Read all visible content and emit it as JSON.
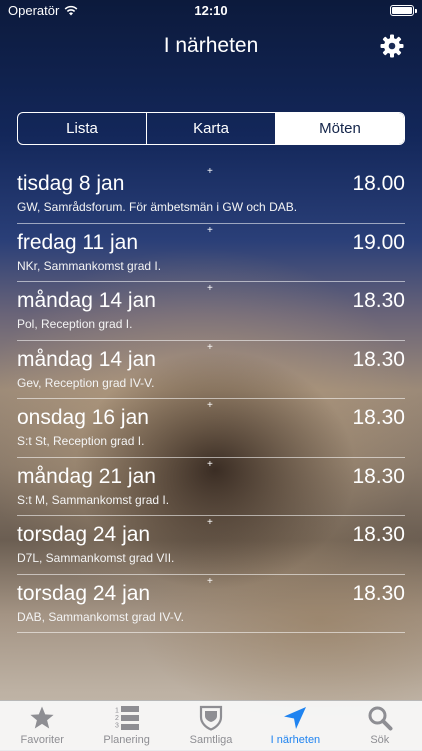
{
  "status_bar": {
    "carrier": "Operatör",
    "time": "12:10"
  },
  "nav": {
    "title": "I närheten",
    "settings_icon": "gear-icon"
  },
  "segments": [
    {
      "label": "Lista",
      "selected": false
    },
    {
      "label": "Karta",
      "selected": false
    },
    {
      "label": "Möten",
      "selected": true
    }
  ],
  "meetings": [
    {
      "date": "tisdag 8 jan",
      "description": "GW, Samrådsforum. För ämbetsmän i GW och DAB.",
      "time": "18.00"
    },
    {
      "date": "fredag 11 jan",
      "description": "NKr, Sammankomst grad I.",
      "time": "19.00"
    },
    {
      "date": "måndag 14 jan",
      "description": "Pol, Reception grad I.",
      "time": "18.30"
    },
    {
      "date": "måndag 14 jan",
      "description": "Gev, Reception grad IV-V.",
      "time": "18.30"
    },
    {
      "date": "onsdag 16 jan",
      "description": "S:t St, Reception grad I.",
      "time": "18.30"
    },
    {
      "date": "måndag 21 jan",
      "description": "S:t M, Sammankomst grad I.",
      "time": "18.30"
    },
    {
      "date": "torsdag 24 jan",
      "description": "D7L, Sammankomst grad VII.",
      "time": "18.30"
    },
    {
      "date": "torsdag 24 jan",
      "description": "DAB, Sammankomst grad IV-V.",
      "time": "18.30"
    }
  ],
  "add_marker": "+",
  "tabs": [
    {
      "label": "Favoriter",
      "icon": "star-icon",
      "active": false
    },
    {
      "label": "Planering",
      "icon": "numbered-list-icon",
      "active": false
    },
    {
      "label": "Samtliga",
      "icon": "shield-icon",
      "active": false
    },
    {
      "label": "I närheten",
      "icon": "location-arrow-icon",
      "active": true
    },
    {
      "label": "Sök",
      "icon": "search-icon",
      "active": false
    }
  ],
  "colors": {
    "accent": "#1f83f0",
    "tab_inactive": "#8e8e93",
    "segment_text_active": "#14254a"
  }
}
